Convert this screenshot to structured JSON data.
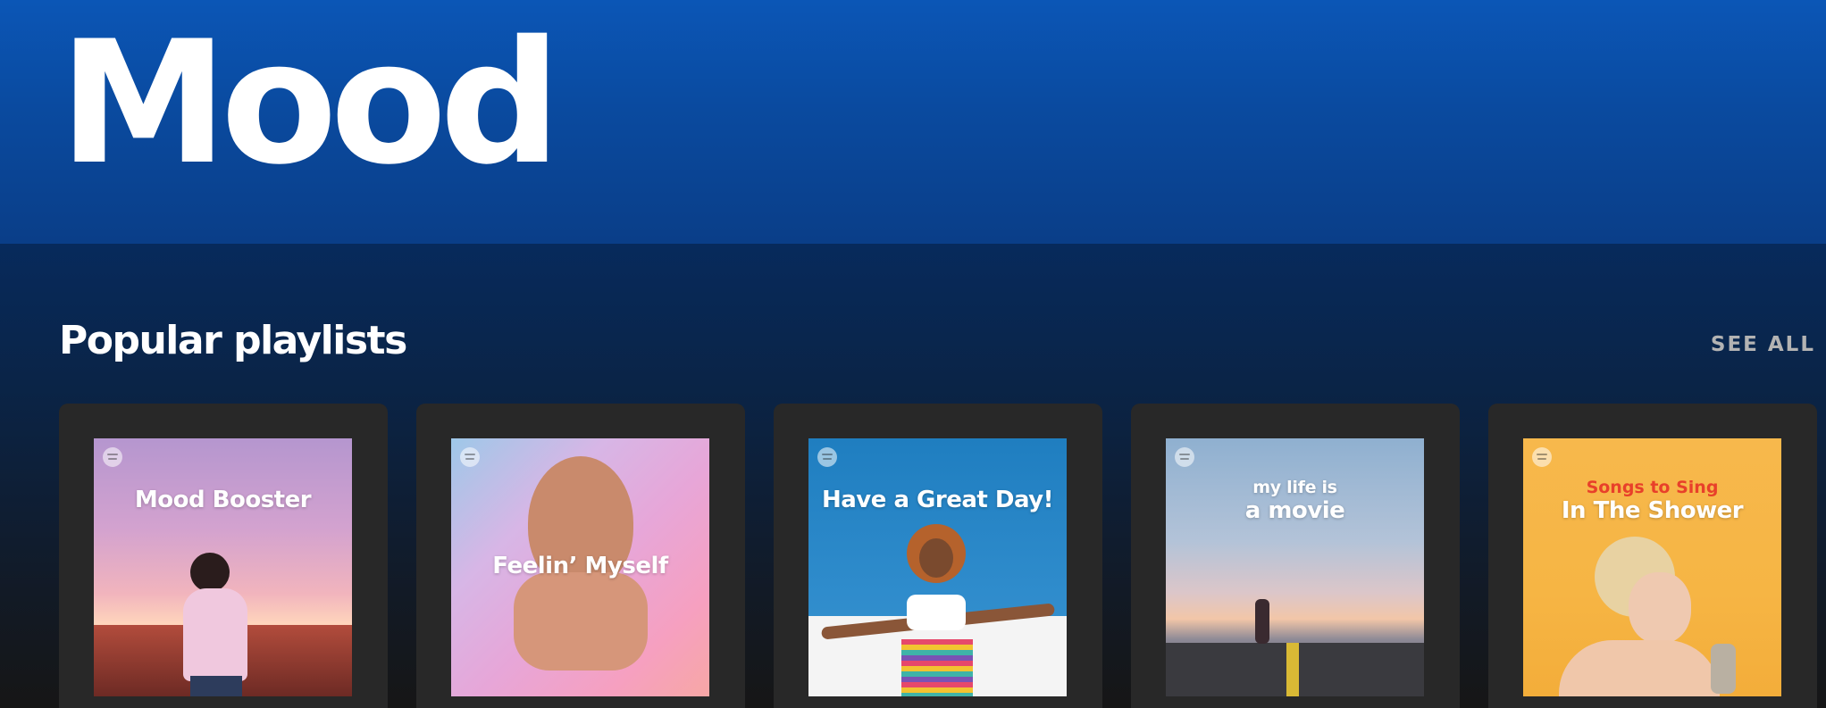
{
  "hero": {
    "title": "Mood"
  },
  "section": {
    "title": "Popular playlists",
    "see_all_label": "SEE ALL"
  },
  "playlists": [
    {
      "title": "Mood Booster",
      "subtitle": "",
      "icon": "spotify-logo-icon"
    },
    {
      "title": "Feelin’ Myself",
      "subtitle": "",
      "icon": "spotify-logo-icon"
    },
    {
      "title": "Have a Great Day!",
      "subtitle": "",
      "icon": "spotify-logo-icon"
    },
    {
      "title": "a movie",
      "subtitle": "my life is",
      "icon": "spotify-logo-icon"
    },
    {
      "title": "In The Shower",
      "subtitle": "Songs to Sing",
      "icon": "spotify-logo-icon"
    }
  ],
  "colors": {
    "hero_blue": "#0b56b6",
    "card_bg": "#282828",
    "see_all": "#b3b3b3",
    "shower_subtitle": "#e8402a"
  }
}
